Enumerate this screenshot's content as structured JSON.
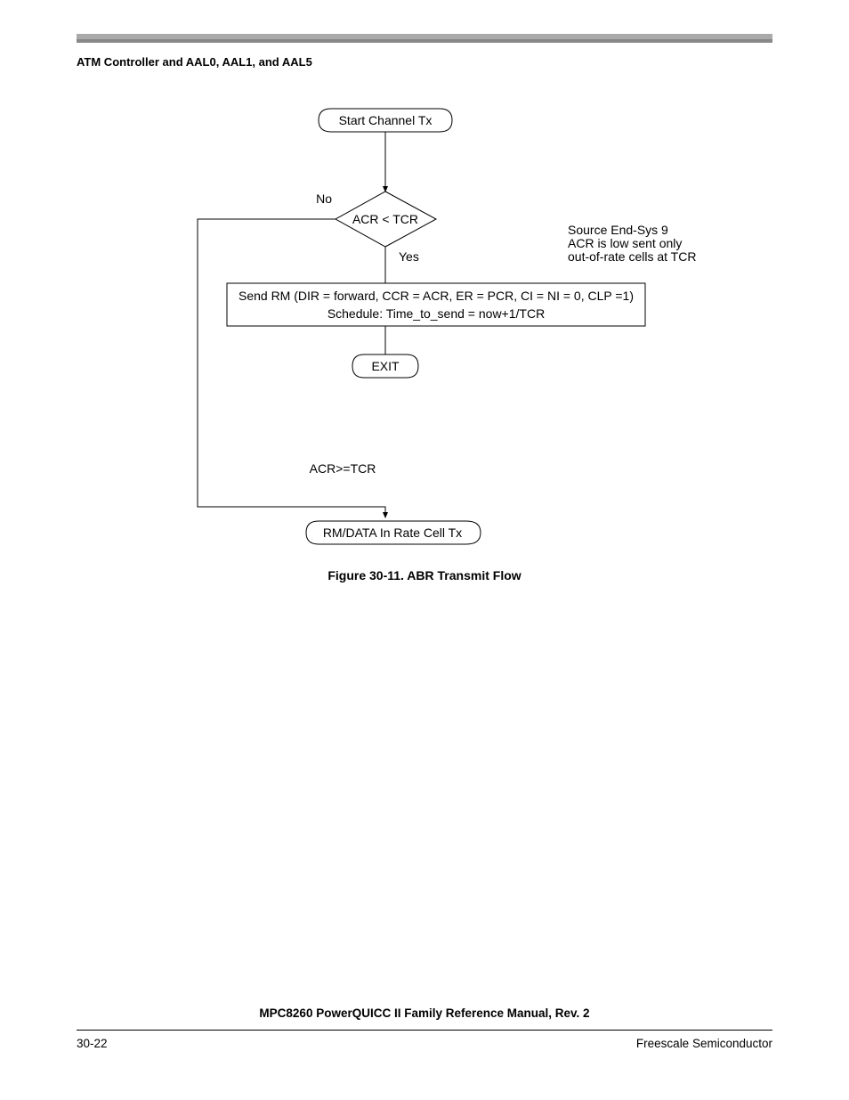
{
  "header": {
    "section_title": "ATM Controller and AAL0, AAL1, and AAL5"
  },
  "flowchart": {
    "start_label": "Start Channel Tx",
    "decision_label": "ACR < TCR",
    "decision_no": "No",
    "decision_yes": "Yes",
    "side_note_line1": "Source End-Sys 9",
    "side_note_line2": "ACR is low sent only",
    "side_note_line3": "out-of-rate cells at TCR",
    "process_line1": "Send RM (DIR = forward, CCR = ACR, ER = PCR, CI = NI = 0, CLP =1)",
    "process_line2": "Schedule: Time_to_send = now+1/TCR",
    "exit_label": "EXIT",
    "bypass_label": "ACR>=TCR",
    "end_label": "RM/DATA In Rate Cell Tx",
    "caption": "Figure 30-11. ABR Transmit Flow"
  },
  "footer": {
    "manual_title": "MPC8260 PowerQUICC II Family Reference Manual, Rev. 2",
    "page_number": "30-22",
    "company": "Freescale Semiconductor"
  }
}
